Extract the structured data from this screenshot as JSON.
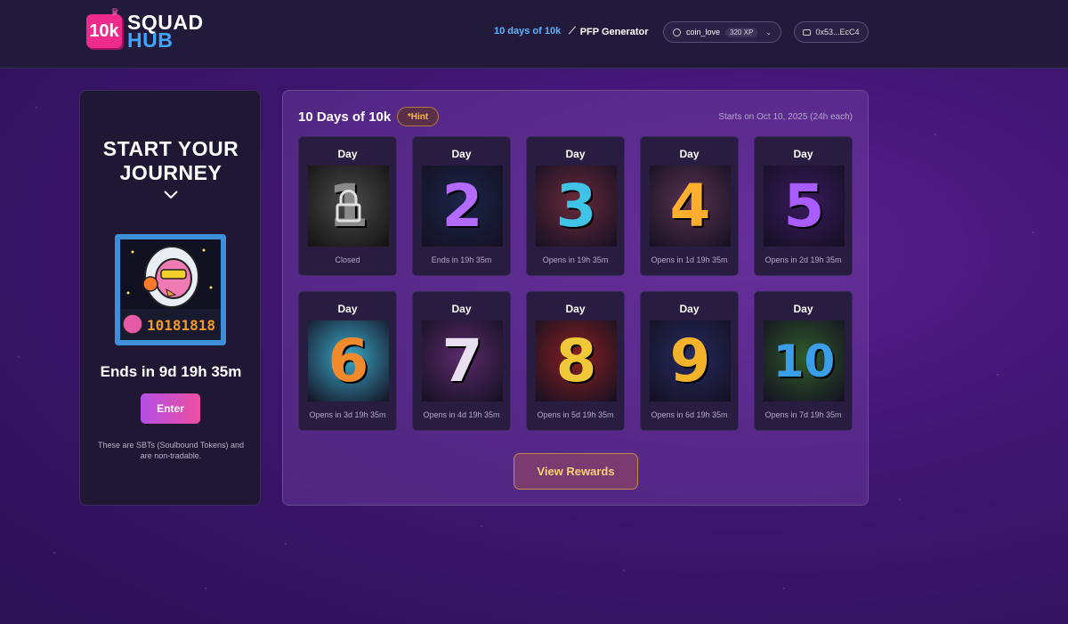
{
  "header": {
    "logo_badge": "10k",
    "logo_line1": "SQUAD",
    "logo_line2": "HUB",
    "nav_days": "10 days of 10k",
    "nav_pfp": "PFP Generator",
    "username": "coin_love",
    "xp": "320 XP",
    "wallet": "0x53...EcC4"
  },
  "journey": {
    "title_line1": "START YOUR",
    "title_line2": "JOURNEY",
    "ends": "Ends in 9d 19h 35m",
    "enter_label": "Enter",
    "note": "These are SBTs (Soulbound Tokens) and are non-tradable.",
    "nft_tiles": "10181818"
  },
  "panel": {
    "title": "10 Days of 10k",
    "hint_label": "*Hint",
    "starts": "Starts on Oct 10, 2025 (24h each)",
    "rewards_label": "View Rewards",
    "days": [
      {
        "label": "Day",
        "number": "1",
        "status": "Closed",
        "bg": "#4a4a4a",
        "fg": "#8a8a8a"
      },
      {
        "label": "Day",
        "number": "2",
        "status": "Ends in 19h 35m",
        "bg": "#1a2548",
        "fg": "#b36bff"
      },
      {
        "label": "Day",
        "number": "3",
        "status": "Opens in 19h 35m",
        "bg": "#6a2a3a",
        "fg": "#3fc4e8"
      },
      {
        "label": "Day",
        "number": "4",
        "status": "Opens in 1d 19h 35m",
        "bg": "#5a3350",
        "fg": "#ffae2e"
      },
      {
        "label": "Day",
        "number": "5",
        "status": "Opens in 2d 19h 35m",
        "bg": "#3a1a5e",
        "fg": "#a95cff"
      },
      {
        "label": "Day",
        "number": "6",
        "status": "Opens in 3d 19h 35m",
        "bg": "#3aa8c8",
        "fg": "#f08a2a"
      },
      {
        "label": "Day",
        "number": "7",
        "status": "Opens in 4d 19h 35m",
        "bg": "#5a2a6a",
        "fg": "#e8e0f0"
      },
      {
        "label": "Day",
        "number": "8",
        "status": "Opens in 5d 19h 35m",
        "bg": "#8a2020",
        "fg": "#f0c83a"
      },
      {
        "label": "Day",
        "number": "9",
        "status": "Opens in 6d 19h 35m",
        "bg": "#252a5e",
        "fg": "#f2b22a"
      },
      {
        "label": "Day",
        "number": "10",
        "status": "Opens in 7d 19h 35m",
        "bg": "#2f5a2a",
        "fg": "#3a9ee8"
      }
    ]
  }
}
